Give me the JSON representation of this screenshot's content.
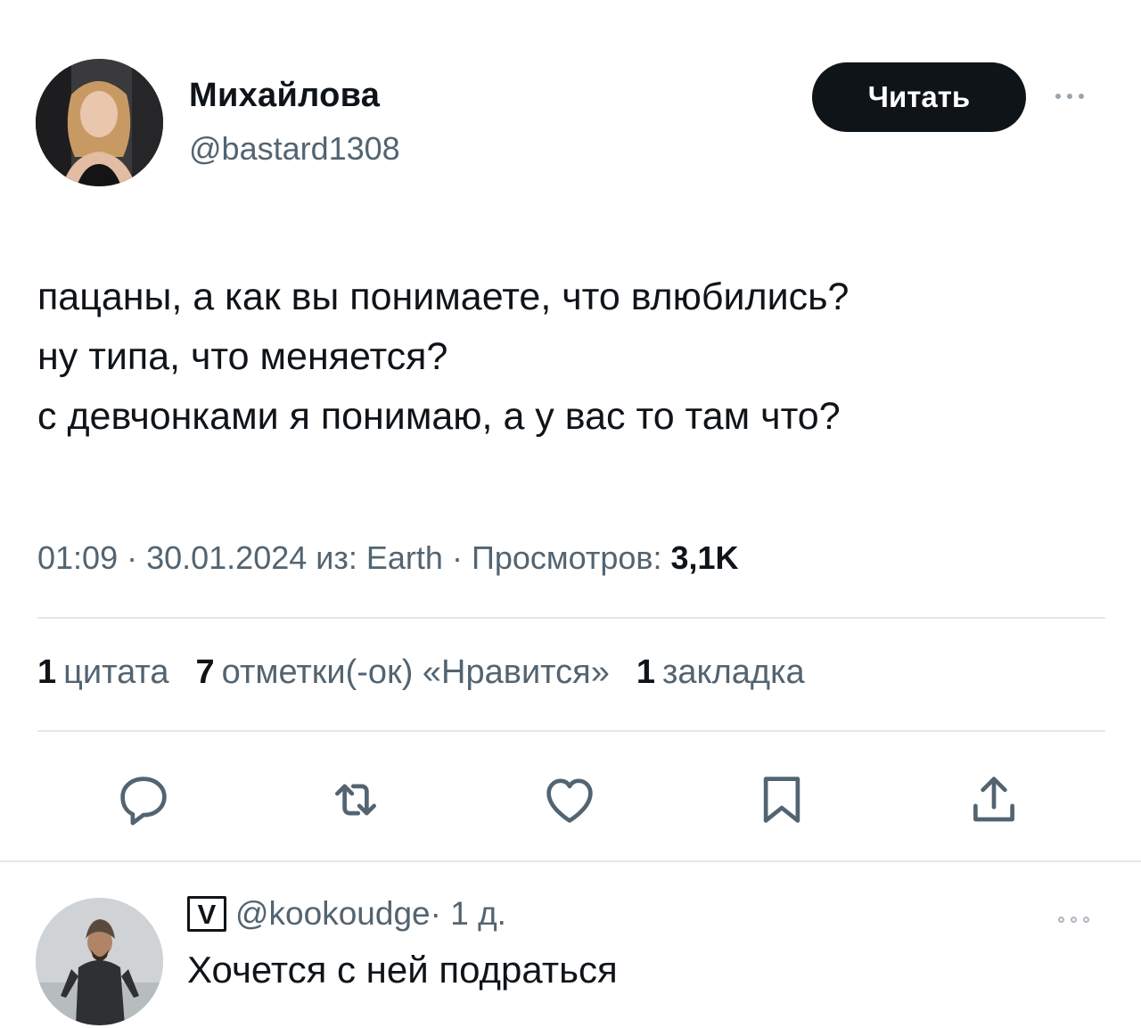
{
  "tweet": {
    "author": {
      "display_name": "Михайлова",
      "handle": "@bastard1308",
      "avatar_icon": "user-avatar-photo"
    },
    "follow_label": "Читать",
    "more_icon": "more-dots-icon",
    "text_lines": [
      "пацаны, а как вы понимаете, что влюбились?",
      "ну типа, что меняется?",
      "с девчонками я понимаю, а у вас то там что?"
    ],
    "meta": {
      "time": "01:09",
      "sep1": " · ",
      "date": "30.01.2024",
      "source": " из: Earth",
      "sep2": " · ",
      "views_label": "Просмотров: ",
      "views_value": "3,1K"
    },
    "stats": [
      {
        "count": "1",
        "label": "цитата"
      },
      {
        "count": "7",
        "label": "отметки(-ок) «Нравится»"
      },
      {
        "count": "1",
        "label": "закладка"
      }
    ],
    "actions": [
      {
        "name": "reply",
        "icon": "reply-bubble-icon"
      },
      {
        "name": "retweet",
        "icon": "retweet-icon"
      },
      {
        "name": "like",
        "icon": "heart-icon"
      },
      {
        "name": "bookmark",
        "icon": "bookmark-icon"
      },
      {
        "name": "share",
        "icon": "share-icon"
      }
    ]
  },
  "reply": {
    "badge": "V",
    "handle": "@kookoudge",
    "time": " · 1 д.",
    "text": "Хочется с ней подраться",
    "avatar_icon": "user-avatar-photo"
  },
  "colors": {
    "text_primary": "#0f1419",
    "text_secondary": "#536471",
    "divider": "#e4e8eb",
    "button_bg": "#0f1419",
    "button_text": "#ffffff"
  }
}
